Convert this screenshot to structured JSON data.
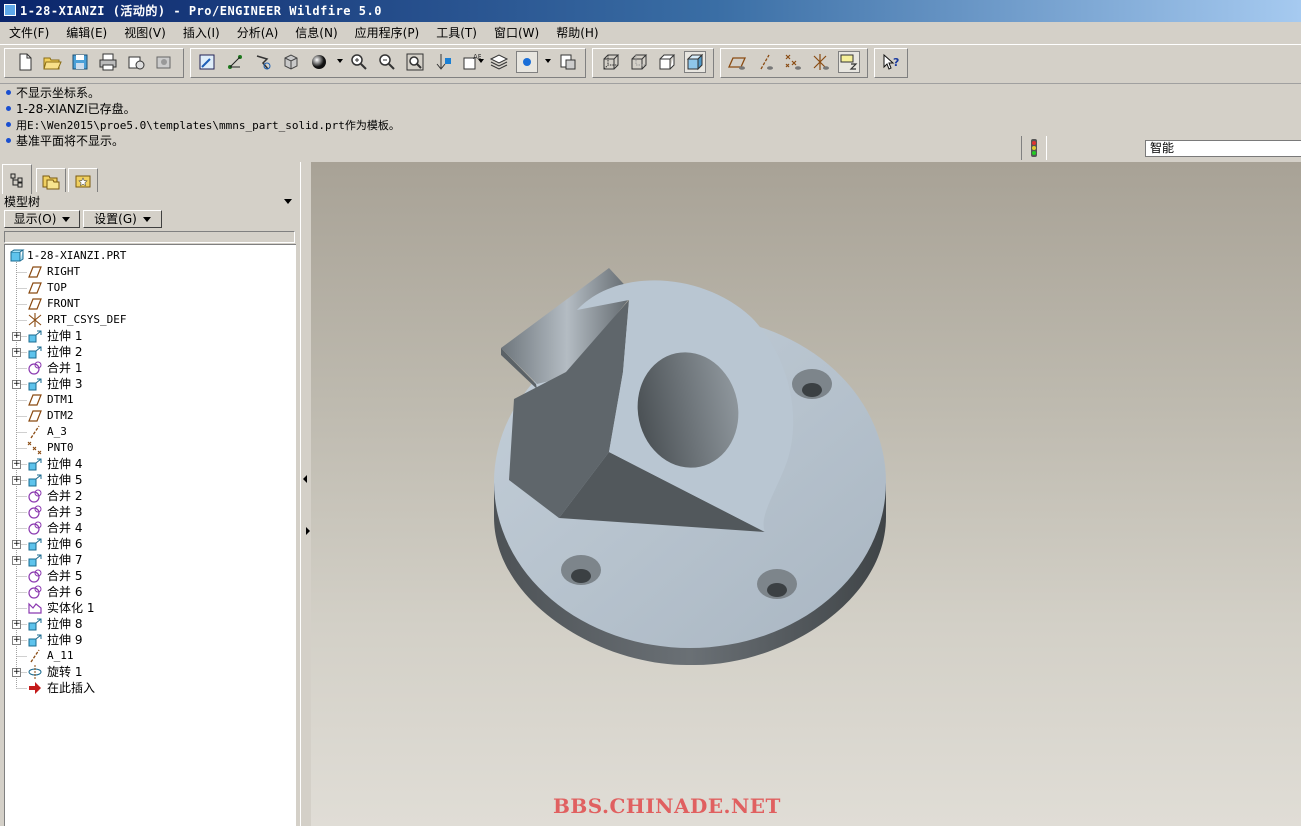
{
  "window": {
    "title": "1-28-XIANZI (活动的) - Pro/ENGINEER Wildfire 5.0"
  },
  "menu": [
    {
      "label": "文件(F)"
    },
    {
      "label": "编辑(E)"
    },
    {
      "label": "视图(V)"
    },
    {
      "label": "插入(I)"
    },
    {
      "label": "分析(A)"
    },
    {
      "label": "信息(N)"
    },
    {
      "label": "应用程序(P)"
    },
    {
      "label": "工具(T)"
    },
    {
      "label": "窗口(W)"
    },
    {
      "label": "帮助(H)"
    }
  ],
  "toolbar": {
    "icons": [
      "new-icon",
      "open-icon",
      "save-icon",
      "print-icon",
      "send-icon",
      "save-copy-icon",
      "repaint-icon",
      "spin-center-icon",
      "orient-icon",
      "saved-views-icon",
      "shading-icon",
      "zoom-in-icon",
      "zoom-out-icon",
      "refit-icon",
      "reorient-icon",
      "view-manager-icon",
      "layers-icon",
      "appearance-icon",
      "display-style-icon",
      "wireframe-icon",
      "hidden-line-icon",
      "no-hidden-icon",
      "shaded-icon",
      "datum-plane-display-icon",
      "datum-axis-display-icon",
      "datum-point-display-icon",
      "csys-display-icon",
      "annotation-display-icon",
      "context-help-icon"
    ]
  },
  "messages": [
    "不显示坐标系。",
    "1-28-XIANZI已存盘。",
    "用E:\\Wen2015\\proe5.0\\templates\\mmns_part_solid.prt作为模板。",
    "基准平面将不显示。"
  ],
  "filter": {
    "value": "智能"
  },
  "model_tree": {
    "title": "模型树",
    "show_button": "显示(O)",
    "settings_button": "设置(G)",
    "items": [
      {
        "label": "1-28-XIANZI.PRT",
        "icon": "part-icon",
        "expandable": false,
        "root": true
      },
      {
        "label": "RIGHT",
        "icon": "datum-plane-icon",
        "expandable": false
      },
      {
        "label": "TOP",
        "icon": "datum-plane-icon",
        "expandable": false
      },
      {
        "label": "FRONT",
        "icon": "datum-plane-icon",
        "expandable": false
      },
      {
        "label": "PRT_CSYS_DEF",
        "icon": "csys-icon",
        "expandable": false
      },
      {
        "label": "拉伸 1",
        "icon": "extrude-icon",
        "expandable": true
      },
      {
        "label": "拉伸 2",
        "icon": "extrude-icon",
        "expandable": true
      },
      {
        "label": "合并 1",
        "icon": "merge-icon",
        "expandable": false
      },
      {
        "label": "拉伸 3",
        "icon": "extrude-icon",
        "expandable": true
      },
      {
        "label": "DTM1",
        "icon": "datum-plane-icon",
        "expandable": false
      },
      {
        "label": "DTM2",
        "icon": "datum-plane-icon",
        "expandable": false
      },
      {
        "label": "A_3",
        "icon": "axis-icon",
        "expandable": false
      },
      {
        "label": "PNT0",
        "icon": "datum-point-icon",
        "expandable": false
      },
      {
        "label": "拉伸 4",
        "icon": "extrude-icon",
        "expandable": true
      },
      {
        "label": "拉伸 5",
        "icon": "extrude-icon",
        "expandable": true
      },
      {
        "label": "合并 2",
        "icon": "merge-icon",
        "expandable": false
      },
      {
        "label": "合并 3",
        "icon": "merge-icon",
        "expandable": false
      },
      {
        "label": "合并 4",
        "icon": "merge-icon",
        "expandable": false
      },
      {
        "label": "拉伸 6",
        "icon": "extrude-icon",
        "expandable": true
      },
      {
        "label": "拉伸 7",
        "icon": "extrude-icon",
        "expandable": true
      },
      {
        "label": "合并 5",
        "icon": "merge-icon",
        "expandable": false
      },
      {
        "label": "合并 6",
        "icon": "merge-icon",
        "expandable": false
      },
      {
        "label": "实体化 1",
        "icon": "solidify-icon",
        "expandable": false
      },
      {
        "label": "拉伸 8",
        "icon": "extrude-icon",
        "expandable": true
      },
      {
        "label": "拉伸 9",
        "icon": "extrude-icon",
        "expandable": true
      },
      {
        "label": "A_11",
        "icon": "axis-icon",
        "expandable": false
      },
      {
        "label": "旋转 1",
        "icon": "revolve-icon",
        "expandable": true
      },
      {
        "label": "在此插入",
        "icon": "insert-here-icon",
        "expandable": false
      }
    ]
  },
  "watermark": "BBS.CHINADE.NET",
  "colors": {
    "title_bar": "#0a246a",
    "model_surface": "#b7c4d0",
    "model_dark": "#5d6368",
    "watermark": "#e06060"
  }
}
